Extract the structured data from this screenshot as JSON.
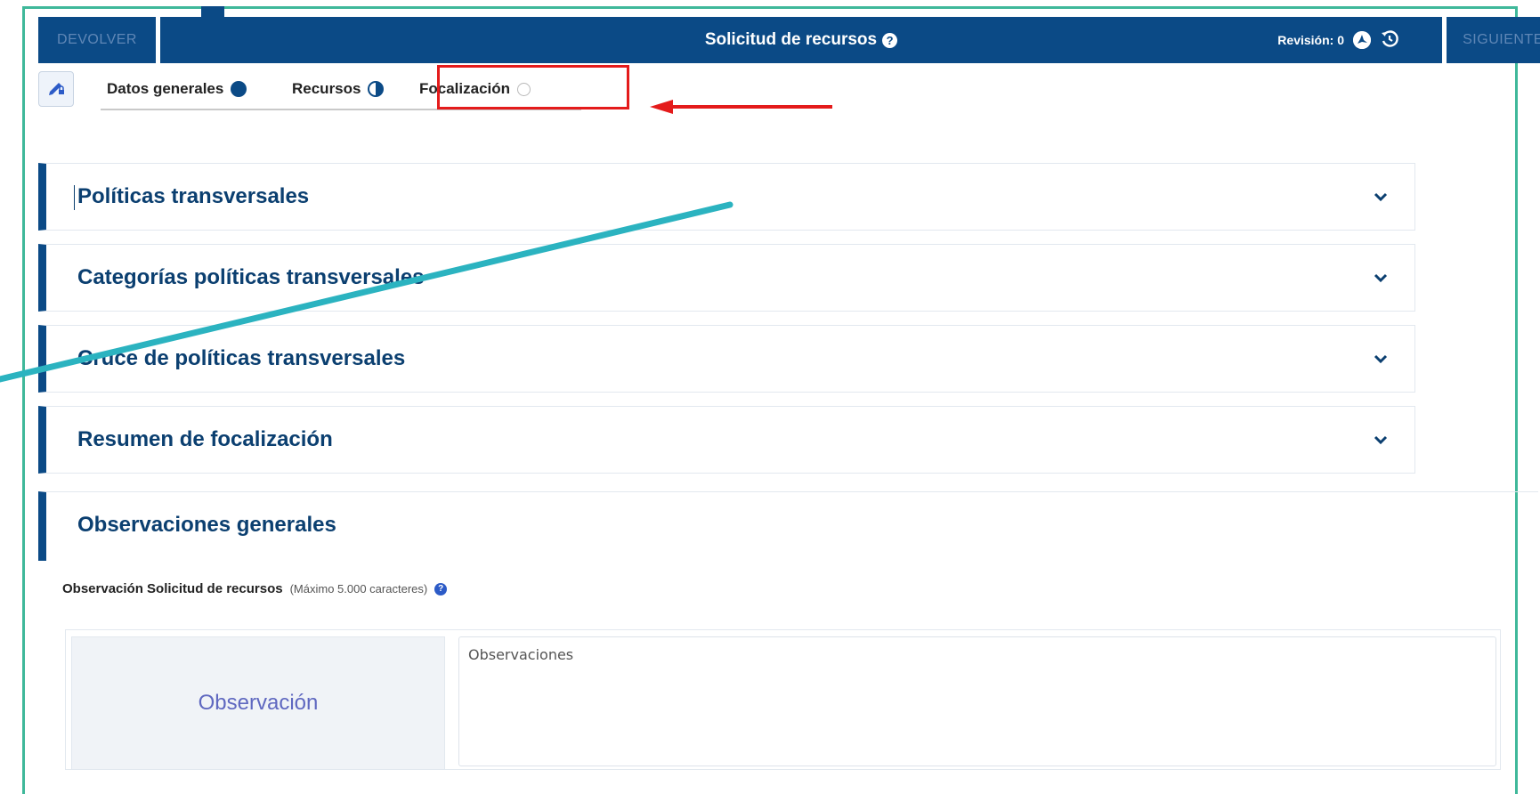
{
  "header": {
    "back_button": "DEVOLVER",
    "title": "Solicitud de recursos",
    "title_help": "?",
    "revision": "Revisión: 0",
    "next_button": "SIGUIENTE"
  },
  "steps": [
    {
      "label": "Datos generales",
      "status": "complete"
    },
    {
      "label": "Recursos",
      "status": "partial"
    },
    {
      "label": "Focalización",
      "status": "empty"
    }
  ],
  "sections": [
    {
      "title": "Políticas transversales"
    },
    {
      "title": "Categorías políticas transversales"
    },
    {
      "title": "Cruce de políticas transversales"
    },
    {
      "title": "Resumen de focalización"
    }
  ],
  "observations": {
    "section_title": "Observaciones generales",
    "field_label": "Observación Solicitud de recursos",
    "field_hint": "(Máximo 5.000 caracteres)",
    "left_label": "Observación",
    "placeholder": "Observaciones"
  },
  "colors": {
    "primary": "#0b4a86",
    "frame": "#3fb89a",
    "highlight": "#e41b1b",
    "annotation_line": "#2bb3c0"
  },
  "icons": {
    "edit": "pencil-lock-icon",
    "pdf": "pdf-icon",
    "history": "history-icon",
    "chevron": "chevron-down-icon",
    "help": "help-icon"
  }
}
